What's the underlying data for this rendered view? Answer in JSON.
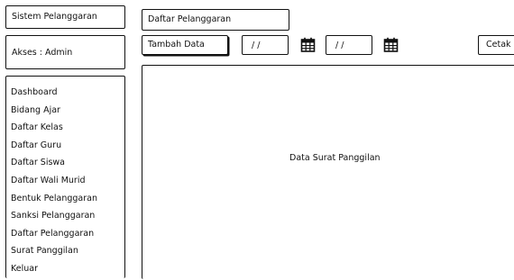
{
  "sidebar": {
    "app_title": "Sistem Pelanggaran",
    "access_label": "Akses : Admin",
    "menu": [
      "Dashboard",
      "Bidang Ajar",
      "Daftar Kelas",
      "Daftar Guru",
      "Daftar Siswa",
      "Daftar Wali Murid",
      "Bentuk Pelanggaran",
      "Sanksi Pelanggaran",
      "Daftar Pelanggaran",
      "Surat Panggilan",
      "Keluar"
    ]
  },
  "header": {
    "page_title": "Daftar Pelanggaran"
  },
  "toolbar": {
    "add_label": "Tambah Data",
    "date_from": "/ /",
    "date_to": "/ /",
    "calendar_icon": "calendar-icon",
    "print_label": "Cetak"
  },
  "main": {
    "placeholder_text": "Data Surat Panggilan"
  }
}
